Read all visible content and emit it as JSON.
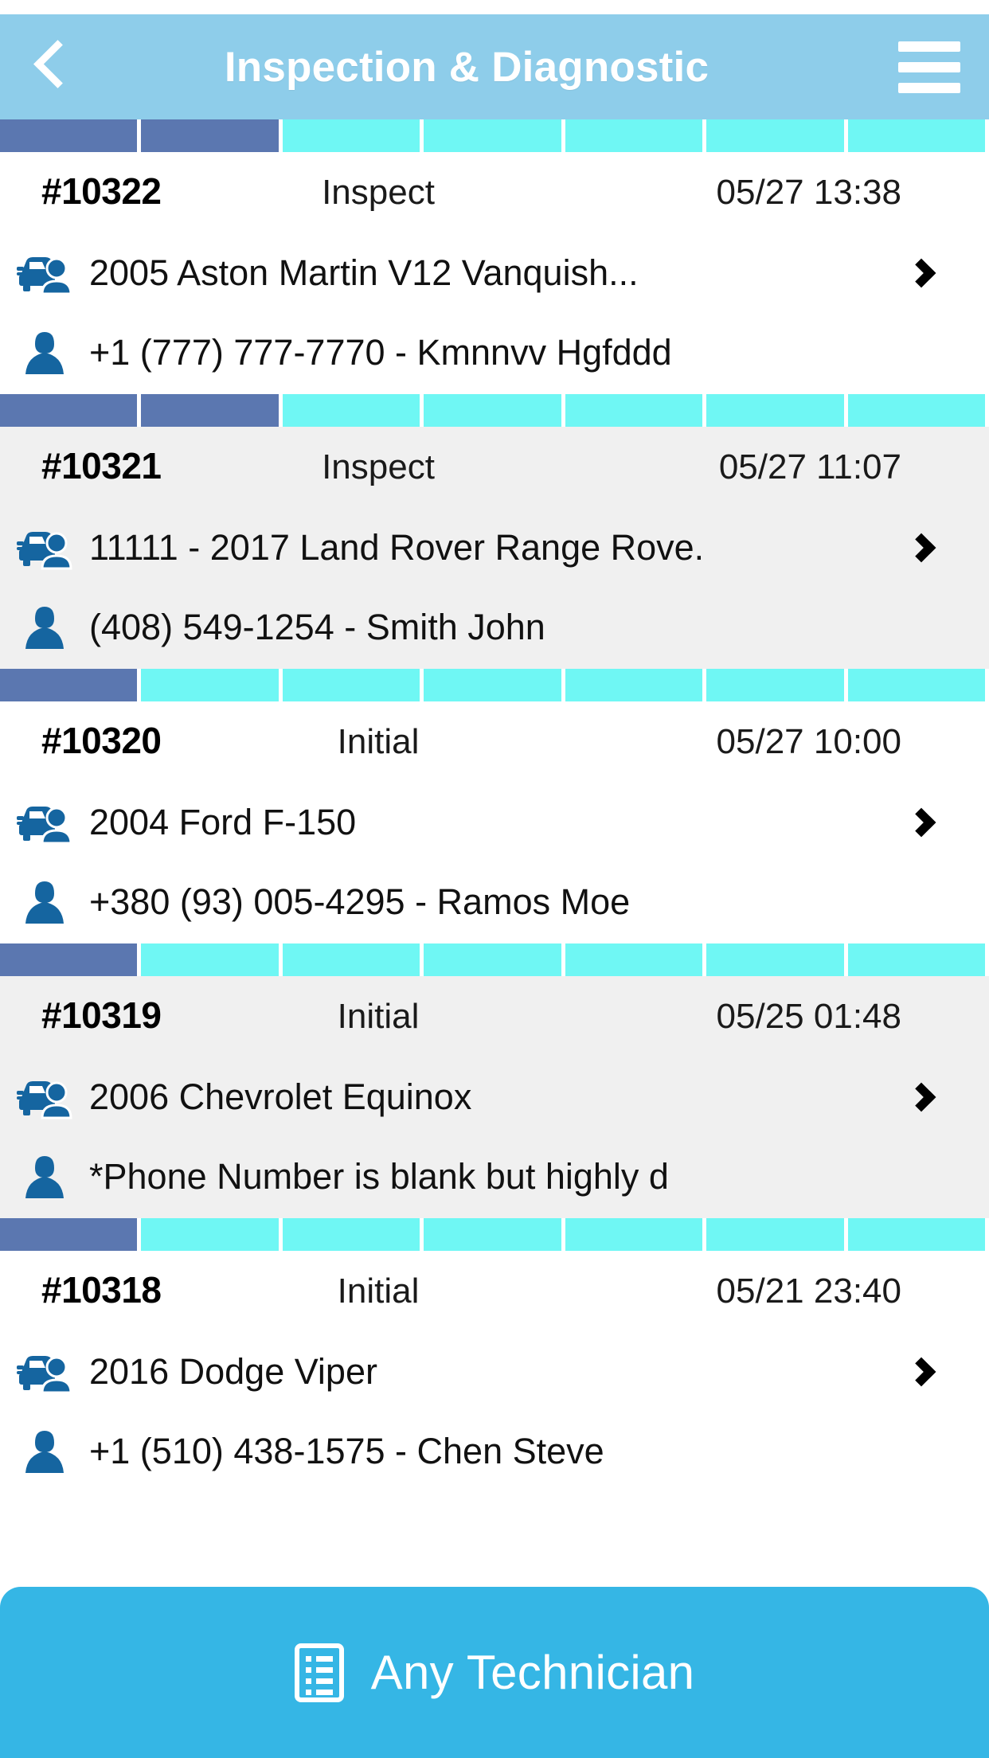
{
  "header": {
    "title": "Inspection & Diagnostic",
    "back_icon": "back-chevron-icon",
    "menu_icon": "hamburger-menu-icon"
  },
  "colors": {
    "header_bg": "#8ecdea",
    "progress_done": "#5b77b0",
    "progress_todo": "#6ff7f4",
    "bottom_bar": "#35b6e5",
    "icon_blue": "#1565a0",
    "alt_row_bg": "#f0f0f0"
  },
  "list": {
    "segments_total": 7,
    "items": [
      {
        "ticket": "#10322",
        "type": "Inspect",
        "date": "05/27 13:38",
        "vehicle": "2005 Aston Martin V12 Vanquish...",
        "contact": "+1 (777) 777-7770 - Kmnnvv Hgfddd",
        "segments_done": 2,
        "vehicle_icon": "car-person-icon",
        "contact_icon": "person-icon",
        "chevron_icon": "chevron-right-icon"
      },
      {
        "ticket": "#10321",
        "type": "Inspect",
        "date": "05/27 11:07",
        "vehicle": "11111 - 2017 Land Rover Range Rove.",
        "contact": "(408) 549-1254 - Smith John",
        "segments_done": 2,
        "vehicle_icon": "car-person-icon",
        "contact_icon": "person-icon",
        "chevron_icon": "chevron-right-icon"
      },
      {
        "ticket": "#10320",
        "type": "Initial",
        "date": "05/27 10:00",
        "vehicle": "2004 Ford F-150",
        "contact": "+380 (93) 005-4295 - Ramos Moe",
        "segments_done": 1,
        "vehicle_icon": "car-person-icon",
        "contact_icon": "person-icon",
        "chevron_icon": "chevron-right-icon"
      },
      {
        "ticket": "#10319",
        "type": "Initial",
        "date": "05/25 01:48",
        "vehicle": "2006 Chevrolet Equinox",
        "contact": "*Phone Number is blank but highly d",
        "segments_done": 1,
        "vehicle_icon": "car-person-icon",
        "contact_icon": "person-icon",
        "chevron_icon": "chevron-right-icon"
      },
      {
        "ticket": "#10318",
        "type": "Initial",
        "date": "05/21 23:40",
        "vehicle": "2016 Dodge Viper",
        "contact": "+1 (510) 438-1575 - Chen Steve",
        "segments_done": 1,
        "vehicle_icon": "car-person-icon",
        "contact_icon": "person-icon",
        "chevron_icon": "chevron-right-icon"
      }
    ]
  },
  "bottom_bar": {
    "label": "Any Technician",
    "icon": "list-document-icon"
  }
}
